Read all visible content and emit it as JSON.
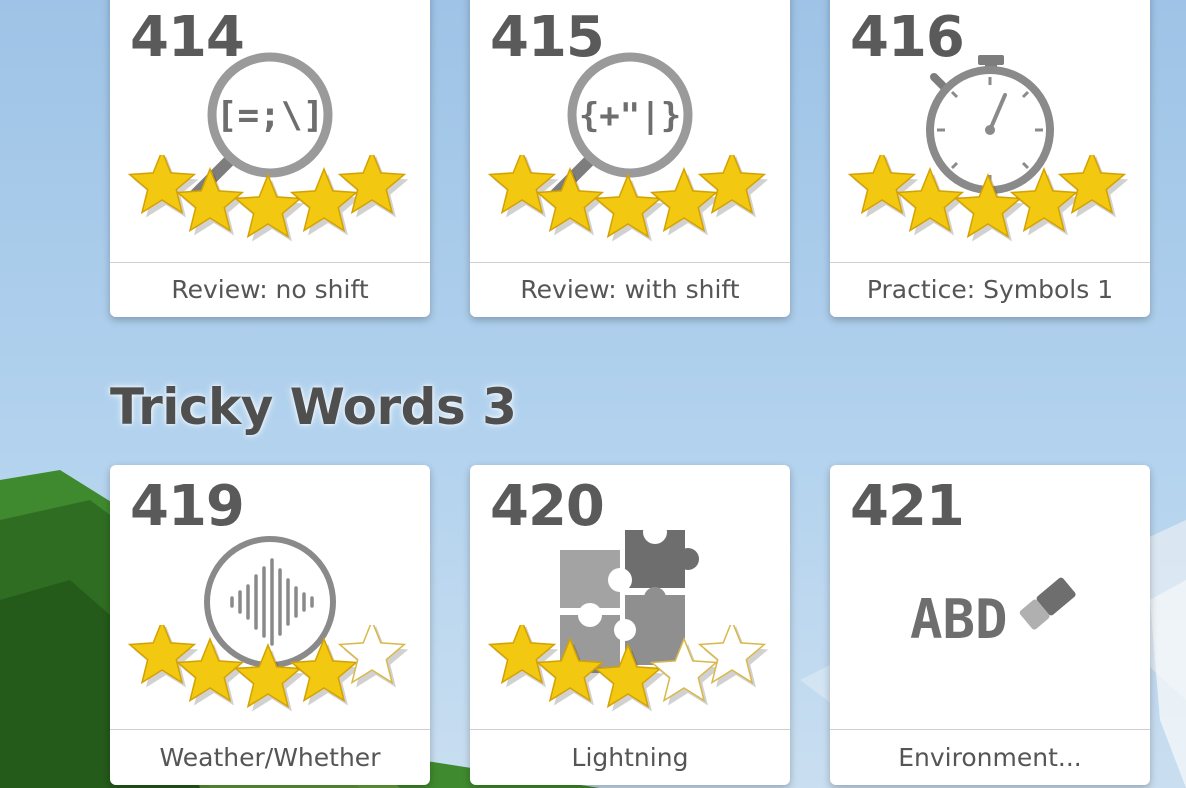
{
  "section": {
    "title": "Tricky Words 3"
  },
  "cards": [
    {
      "number": "414",
      "label": "Review: no shift",
      "icon": "magnifier-keys-icon",
      "icon_text": "[=;\\]",
      "stars_earned": 5,
      "stars_total": 5
    },
    {
      "number": "415",
      "label": "Review: with shift",
      "icon": "magnifier-keys-icon",
      "icon_text": "{+\"|}",
      "stars_earned": 5,
      "stars_total": 5
    },
    {
      "number": "416",
      "label": "Practice: Symbols 1",
      "icon": "stopwatch-icon",
      "stars_earned": 5,
      "stars_total": 5
    },
    {
      "number": "419",
      "label": "Weather/Whether",
      "icon": "soundwave-icon",
      "stars_earned": 4,
      "stars_total": 5
    },
    {
      "number": "420",
      "label": "Lightning",
      "icon": "puzzle-icon",
      "stars_earned": 3,
      "stars_total": 5
    },
    {
      "number": "421",
      "label": "Environment...",
      "icon": "eraser-icon",
      "icon_text": "ABD",
      "stars_earned": 0,
      "stars_total": 5
    }
  ],
  "colors": {
    "star_gold": "#f2c811",
    "icon_gray": "#8a8a8a",
    "text_gray": "#555555"
  }
}
